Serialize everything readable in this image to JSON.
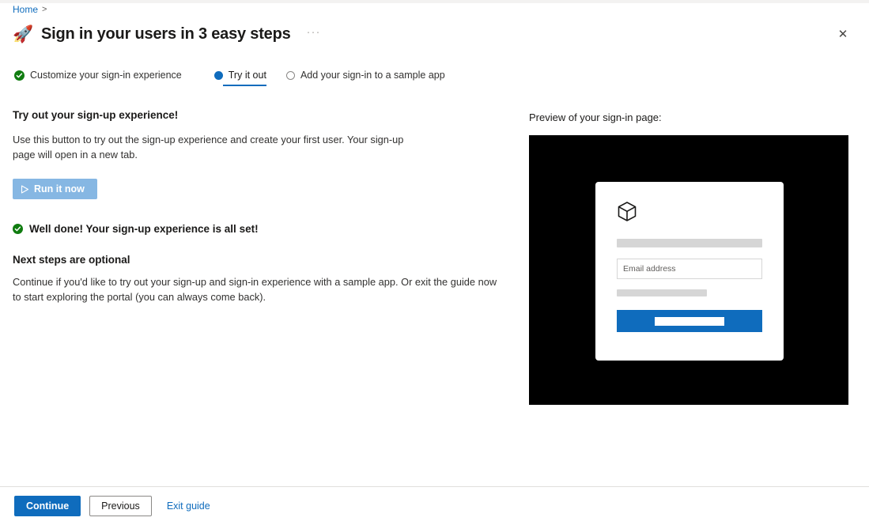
{
  "breadcrumb": {
    "home_label": "Home",
    "separator": ">"
  },
  "header": {
    "icon": "rocket-icon",
    "title": "Sign in your users in 3 easy steps",
    "ellipsis": "···",
    "close_icon": "✕"
  },
  "steps": [
    {
      "label": "Customize your sign-in experience",
      "state": "done",
      "icon": "check-circle-icon"
    },
    {
      "label": "Try it out",
      "state": "active",
      "icon": "filled-circle-icon"
    },
    {
      "label": "Add your sign-in to a sample app",
      "state": "todo",
      "icon": "empty-circle-icon"
    }
  ],
  "main": {
    "section_heading": "Try out your sign-up experience!",
    "section_body": "Use this button to try out the sign-up experience and create your first user. Your sign-up page will open in a new tab.",
    "run_button_label": "Run it now",
    "run_button_icon": "play-icon",
    "run_button_disabled": true,
    "well_done_text": "Well done! Your sign-up experience is all set!",
    "well_done_icon": "check-circle-icon",
    "next_steps_heading": "Next steps are optional",
    "next_steps_body": "Continue if you'd like to try out your sign-up and sign-in experience with a sample app. Or exit the guide now to start exploring the portal (you can always come back)."
  },
  "preview": {
    "label": "Preview of your sign-in page:",
    "card": {
      "logo_icon": "cube-icon",
      "title_placeholder": "",
      "email_placeholder": "Email address",
      "email_value": "",
      "link_placeholder": "",
      "submit_placeholder": ""
    }
  },
  "footer": {
    "continue_label": "Continue",
    "previous_label": "Previous",
    "exit_label": "Exit guide"
  },
  "colors": {
    "accent": "#0f6cbd",
    "success": "#107c10",
    "disabled_button": "#86b7e3",
    "preview_background": "#000000",
    "placeholder_bar": "#d6d6d6"
  }
}
